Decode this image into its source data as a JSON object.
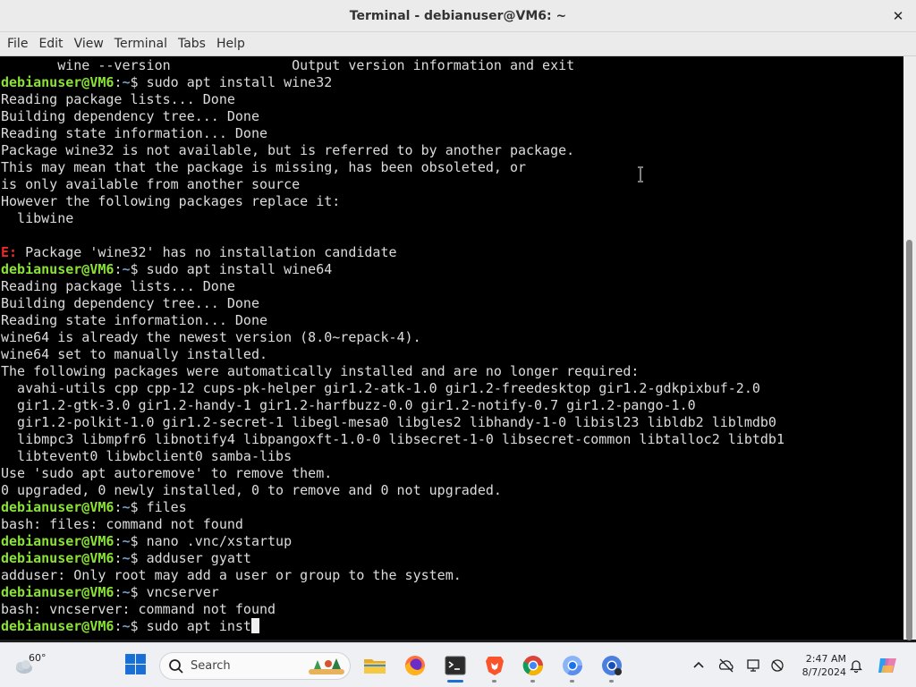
{
  "window": {
    "title": "Terminal - debianuser@VM6: ~",
    "close_glyph": "✕"
  },
  "menu": {
    "items": [
      "File",
      "Edit",
      "View",
      "Terminal",
      "Tabs",
      "Help"
    ]
  },
  "prompt": {
    "user_host": "debianuser@VM6",
    "separator": ":",
    "path": "~",
    "symbol": "$ "
  },
  "terminal": {
    "lines": [
      {
        "kind": "text",
        "text": "       wine --version               Output version information and exit"
      },
      {
        "kind": "prompt",
        "cmd": "sudo apt install wine32"
      },
      {
        "kind": "text",
        "text": "Reading package lists... Done"
      },
      {
        "kind": "text",
        "text": "Building dependency tree... Done"
      },
      {
        "kind": "text",
        "text": "Reading state information... Done"
      },
      {
        "kind": "text",
        "text": "Package wine32 is not available, but is referred to by another package."
      },
      {
        "kind": "text",
        "text": "This may mean that the package is missing, has been obsoleted, or"
      },
      {
        "kind": "text",
        "text": "is only available from another source"
      },
      {
        "kind": "text",
        "text": "However the following packages replace it:"
      },
      {
        "kind": "text",
        "text": "  libwine"
      },
      {
        "kind": "text",
        "text": ""
      },
      {
        "kind": "error",
        "prefix": "E:",
        "text": " Package 'wine32' has no installation candidate"
      },
      {
        "kind": "prompt",
        "cmd": "sudo apt install wine64"
      },
      {
        "kind": "text",
        "text": "Reading package lists... Done"
      },
      {
        "kind": "text",
        "text": "Building dependency tree... Done"
      },
      {
        "kind": "text",
        "text": "Reading state information... Done"
      },
      {
        "kind": "text",
        "text": "wine64 is already the newest version (8.0~repack-4)."
      },
      {
        "kind": "text",
        "text": "wine64 set to manually installed."
      },
      {
        "kind": "text",
        "text": "The following packages were automatically installed and are no longer required:"
      },
      {
        "kind": "text",
        "text": "  avahi-utils cpp cpp-12 cups-pk-helper gir1.2-atk-1.0 gir1.2-freedesktop gir1.2-gdkpixbuf-2.0"
      },
      {
        "kind": "text",
        "text": "  gir1.2-gtk-3.0 gir1.2-handy-1 gir1.2-harfbuzz-0.0 gir1.2-notify-0.7 gir1.2-pango-1.0"
      },
      {
        "kind": "text",
        "text": "  gir1.2-polkit-1.0 gir1.2-secret-1 libegl-mesa0 libgles2 libhandy-1-0 libisl23 libldb2 liblmdb0"
      },
      {
        "kind": "text",
        "text": "  libmpc3 libmpfr6 libnotify4 libpangoxft-1.0-0 libsecret-1-0 libsecret-common libtalloc2 libtdb1"
      },
      {
        "kind": "text",
        "text": "  libtevent0 libwbclient0 samba-libs"
      },
      {
        "kind": "text",
        "text": "Use 'sudo apt autoremove' to remove them."
      },
      {
        "kind": "text",
        "text": "0 upgraded, 0 newly installed, 0 to remove and 0 not upgraded."
      },
      {
        "kind": "prompt",
        "cmd": "files"
      },
      {
        "kind": "text",
        "text": "bash: files: command not found"
      },
      {
        "kind": "prompt",
        "cmd": "nano .vnc/xstartup"
      },
      {
        "kind": "prompt",
        "cmd": "adduser gyatt"
      },
      {
        "kind": "text",
        "text": "adduser: Only root may add a user or group to the system."
      },
      {
        "kind": "prompt",
        "cmd": "vncserver"
      },
      {
        "kind": "text",
        "text": "bash: vncserver: command not found"
      },
      {
        "kind": "prompt",
        "cmd": "sudo apt inst",
        "cursor": true
      }
    ]
  },
  "taskbar": {
    "weather_temp": "60°",
    "search_label": "Search",
    "clock_time": "2:47 AM",
    "clock_date": "8/7/2024",
    "icons": [
      "windows-start-icon",
      "search-icon",
      "file-explorer-icon",
      "firefox-icon",
      "terminal-icon",
      "brave-icon",
      "chrome-icon",
      "chromium-icon",
      "chrome-remote-icon"
    ]
  },
  "colors": {
    "prompt_user": "#8ae234",
    "prompt_path": "#729fcf",
    "error": "#ef2929",
    "terminal_bg": "#000000",
    "terminal_fg": "#dcdcdc",
    "accent": "#1f6fd4"
  }
}
